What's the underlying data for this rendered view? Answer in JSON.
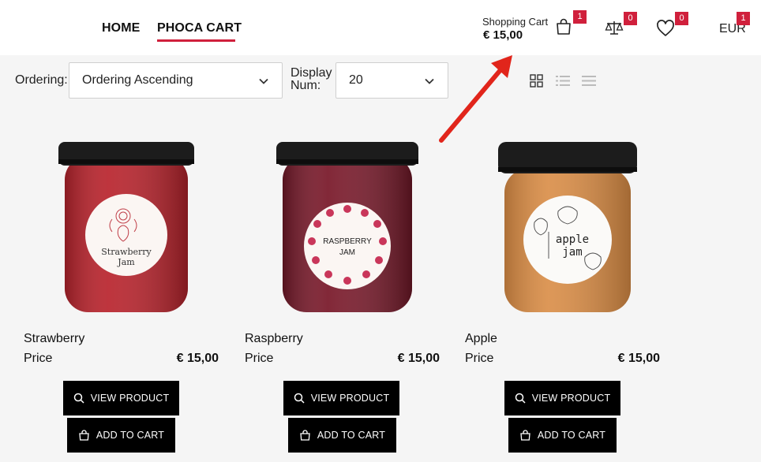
{
  "nav": {
    "home": "HOME",
    "phoca_cart": "PHOCA CART"
  },
  "header": {
    "cart_label": "Shopping Cart",
    "cart_total": "€ 15,00",
    "cart_count": "1",
    "compare_count": "0",
    "wishlist_count": "0",
    "currency": "EUR",
    "currency_count": "1"
  },
  "toolbar": {
    "ordering_label": "Ordering:",
    "ordering_value": "Ordering Ascending",
    "display_label_1": "Display",
    "display_label_2": "Num:",
    "display_value": "20",
    "views": [
      "grid-view-icon",
      "list-view-icon",
      "compact-list-icon"
    ]
  },
  "products": [
    {
      "name": "Strawberry",
      "price_label": "Price",
      "price": "€ 15,00",
      "jar_label_1": "Strawberry",
      "jar_label_2": "Jam",
      "view_label": "VIEW PRODUCT",
      "add_label": "ADD TO CART"
    },
    {
      "name": "Raspberry",
      "price_label": "Price",
      "price": "€ 15,00",
      "jar_label_1": "RASPBERRY",
      "jar_label_2": "JAM",
      "view_label": "VIEW PRODUCT",
      "add_label": "ADD TO CART"
    },
    {
      "name": "Apple",
      "price_label": "Price",
      "price": "€ 15,00",
      "jar_label_1": "apple",
      "jar_label_2": "jam",
      "view_label": "VIEW PRODUCT",
      "add_label": "ADD TO CART"
    }
  ],
  "colors": {
    "accent": "#d0203c",
    "button": "#000000",
    "background": "#f5f5f5"
  }
}
